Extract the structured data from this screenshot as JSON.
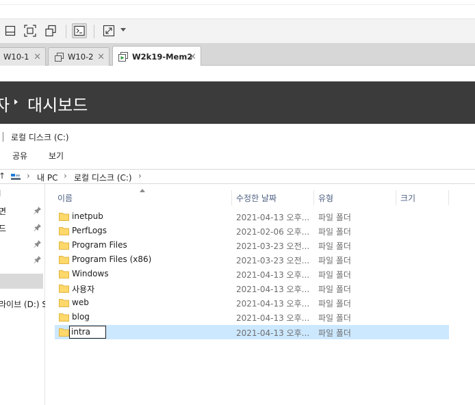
{
  "tabs": [
    {
      "label": "W10-1",
      "close": "×"
    },
    {
      "label": "W10-2",
      "close": "×"
    },
    {
      "label": "W2k19-Mem2",
      "close": "×"
    }
  ],
  "server_manager": {
    "breadcrumb_prev": "자",
    "breadcrumb_current": "대시보드"
  },
  "explorer": {
    "title": "로컬 디스크 (C:)",
    "ribbon": {
      "share": "공유",
      "view": "보기"
    },
    "address": {
      "up": "↑",
      "segments": [
        "내 PC",
        "로컬 디스크 (C:)"
      ],
      "chevron": "›"
    },
    "nav": [
      {
        "label": "l",
        "pinned": false
      },
      {
        "label": "면",
        "pinned": true
      },
      {
        "label": "드",
        "pinned": true
      },
      {
        "label": "",
        "pinned": true
      },
      {
        "label": "",
        "pinned": true
      },
      {
        "label": "",
        "pinned": false,
        "selected": true
      },
      {
        "label": "라이브 (D:) S",
        "pinned": false
      }
    ],
    "columns": {
      "name": "이름",
      "date": "수정한 날짜",
      "type": "유형",
      "size": "크기"
    },
    "files": [
      {
        "name": "inetpub",
        "date": "2021-04-13 오후...",
        "type": "파일 폴더"
      },
      {
        "name": "PerfLogs",
        "date": "2021-02-06 오후...",
        "type": "파일 폴더"
      },
      {
        "name": "Program Files",
        "date": "2021-03-23 오전...",
        "type": "파일 폴더"
      },
      {
        "name": "Program Files (x86)",
        "date": "2021-03-23 오전...",
        "type": "파일 폴더"
      },
      {
        "name": "Windows",
        "date": "2021-04-13 오후...",
        "type": "파일 폴더"
      },
      {
        "name": "사용자",
        "date": "2021-04-13 오후...",
        "type": "파일 폴더"
      },
      {
        "name": "web",
        "date": "2021-04-13 오후...",
        "type": "파일 폴더"
      },
      {
        "name": "blog",
        "date": "2021-04-13 오후...",
        "type": "파일 폴더"
      },
      {
        "name": "intra",
        "date": "2021-04-13 오후...",
        "type": "파일 폴더"
      }
    ]
  },
  "colors": {
    "header_bg": "#3b3b3b",
    "selection_bg": "#cce8ff",
    "folder_yellow": "#ffd86b",
    "column_header_text": "#4d6082"
  },
  "icons": {
    "toolbar": [
      "window-restore-icon",
      "fit-guest-icon",
      "multi-window-icon",
      "console-icon",
      "fullscreen-icon"
    ]
  }
}
